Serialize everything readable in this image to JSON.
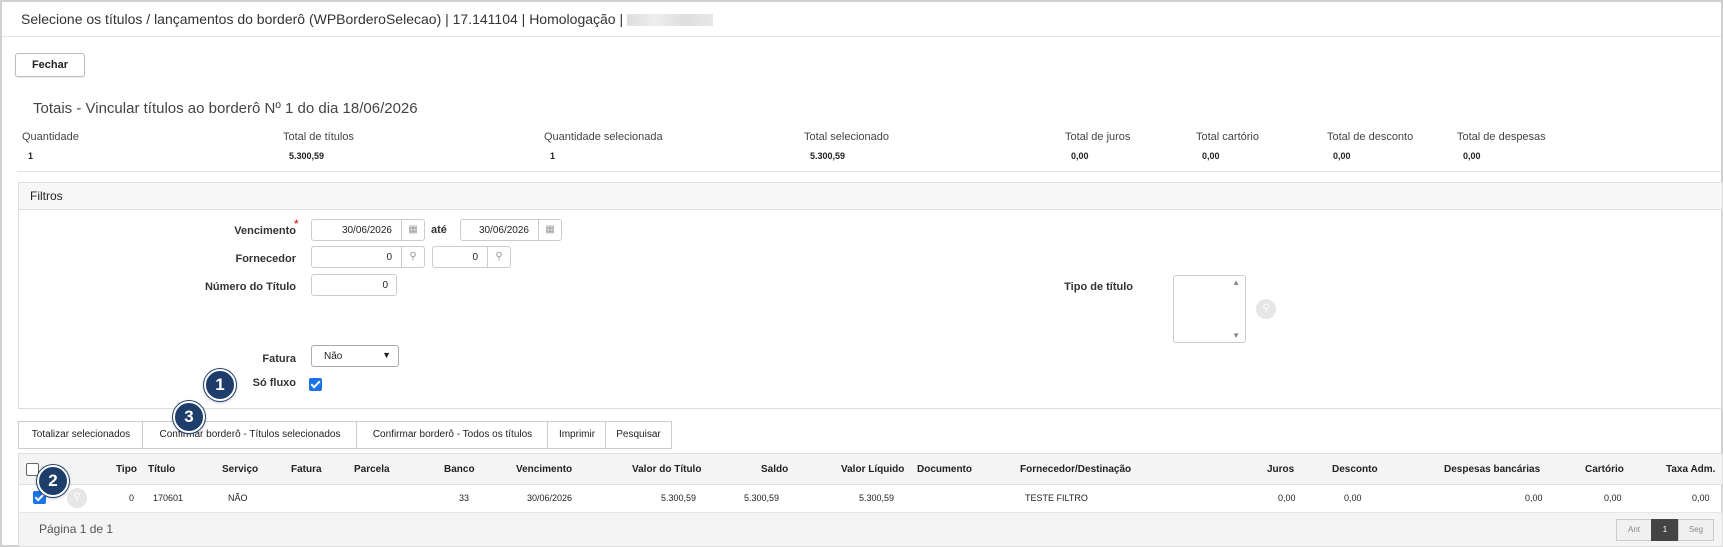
{
  "window": {
    "title": "Selecione os títulos / lançamentos do borderô (WPBorderoSelecao) | 17.141104 | Homologação |"
  },
  "close_button": "Fechar",
  "heading": "Totais - Vincular títulos ao borderô Nº 1 do dia 18/06/2026",
  "totals": [
    {
      "label": "Quantidade",
      "value": "1"
    },
    {
      "label": "Total de títulos",
      "value": "5.300,59"
    },
    {
      "label": "Quantidade selecionada",
      "value": "1"
    },
    {
      "label": "Total selecionado",
      "value": "5.300,59"
    },
    {
      "label": "Total de juros",
      "value": "0,00"
    },
    {
      "label": "Total cartório",
      "value": "0,00"
    },
    {
      "label": "Total de desconto",
      "value": "0,00"
    },
    {
      "label": "Total de despesas",
      "value": "0,00"
    }
  ],
  "filters": {
    "title": "Filtros",
    "vencimento": {
      "label": "Vencimento",
      "required": "*",
      "from": "30/06/2026",
      "to_label": "até",
      "to": "30/06/2026"
    },
    "fornecedor": {
      "label": "Fornecedor",
      "from": "0",
      "to": "0"
    },
    "numero_titulo": {
      "label": "Número do Título",
      "value": "0"
    },
    "tipo_titulo": {
      "label": "Tipo de título"
    },
    "fatura": {
      "label": "Fatura",
      "value": "Não"
    },
    "so_fluxo": {
      "label": "Só fluxo",
      "checked": true
    }
  },
  "toolbar": [
    "Totalizar selecionados",
    "Confirmar borderô - Títulos selecionados",
    "Confirmar borderô - Todos os títulos",
    "Imprimir",
    "Pesquisar"
  ],
  "grid": {
    "columns": [
      "Tipo",
      "Título",
      "Serviço",
      "Fatura",
      "Parcela",
      "Banco",
      "Vencimento",
      "Valor do Título",
      "Saldo",
      "Valor Líquido",
      "Documento",
      "Fornecedor/Destinação",
      "Juros",
      "Desconto",
      "Despesas bancárias",
      "Cartório",
      "Taxa Adm."
    ],
    "rows": [
      {
        "tipo": "0",
        "titulo": "170601",
        "servico": "NÃO",
        "fatura": "",
        "parcela": "",
        "banco": "33",
        "vencimento": "30/06/2026",
        "valor": "5.300,59",
        "saldo": "5.300,59",
        "liquido": "5.300,59",
        "documento": "",
        "fornecedor": "TESTE FILTRO",
        "juros": "0,00",
        "desconto": "0,00",
        "despesas": "0,00",
        "cartorio": "0,00",
        "taxa": "0,00"
      }
    ],
    "footer": {
      "page_info": "Página 1 de 1",
      "prev": "Ant",
      "page": "1",
      "next": "Seg"
    }
  },
  "callouts": [
    "1",
    "2",
    "3"
  ],
  "colors": {
    "callout": "#1f3d6b",
    "checkbox": "#1a73e8",
    "required": "#dd0000"
  }
}
